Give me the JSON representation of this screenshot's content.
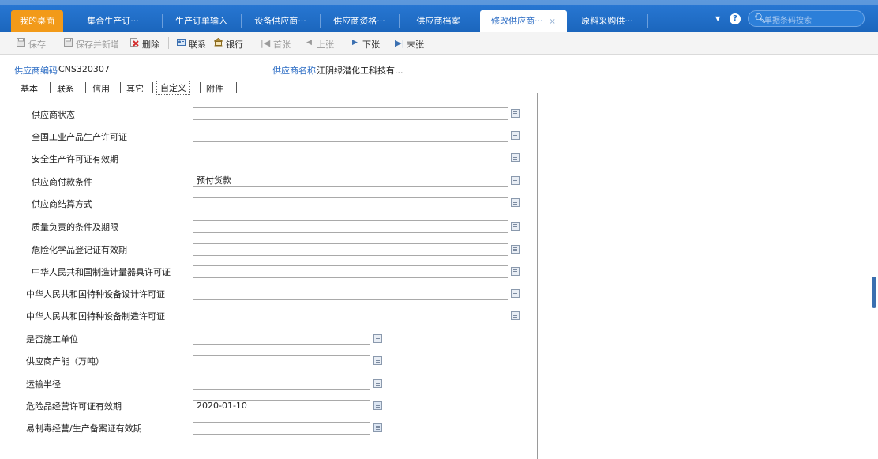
{
  "tabs": [
    {
      "label": "我的桌面"
    },
    {
      "label": "集合生产订···"
    },
    {
      "label": "生产订单输入"
    },
    {
      "label": "设备供应商···"
    },
    {
      "label": "供应商资格···"
    },
    {
      "label": "供应商档案"
    },
    {
      "label": "修改供应商···",
      "close": "×"
    },
    {
      "label": "原料采购供···"
    }
  ],
  "search": {
    "placeholder": "单据条码搜索"
  },
  "help_label": "?",
  "dropdown_label": "▼",
  "toolbar": {
    "save": "保存",
    "save_new": "保存并新增",
    "delete": "删除",
    "contact": "联系",
    "bank": "银行",
    "first": "首张",
    "prev": "上张",
    "next": "下张",
    "last": "末张"
  },
  "header": {
    "code_label": "供应商编码",
    "code_value": "CNS320307",
    "name_label": "供应商名称",
    "name_value": "江阴绿潜化工科技有..."
  },
  "subtabs": [
    "基本",
    "联系",
    "信用",
    "其它",
    "自定义",
    "附件"
  ],
  "fields": [
    {
      "label": "供应商状态",
      "value": ""
    },
    {
      "label": "全国工业产品生产许可证",
      "value": ""
    },
    {
      "label": "安全生产许可证有效期",
      "value": ""
    },
    {
      "label": "供应商付款条件",
      "value": "预付货款"
    },
    {
      "label": "供应商结算方式",
      "value": ""
    },
    {
      "label": "质量负责的条件及期限",
      "value": ""
    },
    {
      "label": "危险化学品登记证有效期",
      "value": ""
    },
    {
      "label": "中华人民共和国制造计量器具许可证",
      "value": ""
    },
    {
      "label": "中华人民共和国特种设备设计许可证",
      "value": ""
    },
    {
      "label": "中华人民共和国特种设备制造许可证",
      "value": ""
    },
    {
      "label": "是否施工单位",
      "value": ""
    },
    {
      "label": "供应商产能（万吨）",
      "value": ""
    },
    {
      "label": "运输半径",
      "value": ""
    },
    {
      "label": "危险品经营许可证有效期",
      "value": "2020-01-10"
    },
    {
      "label": "易制毒经营/生产备案证有效期",
      "value": ""
    }
  ]
}
